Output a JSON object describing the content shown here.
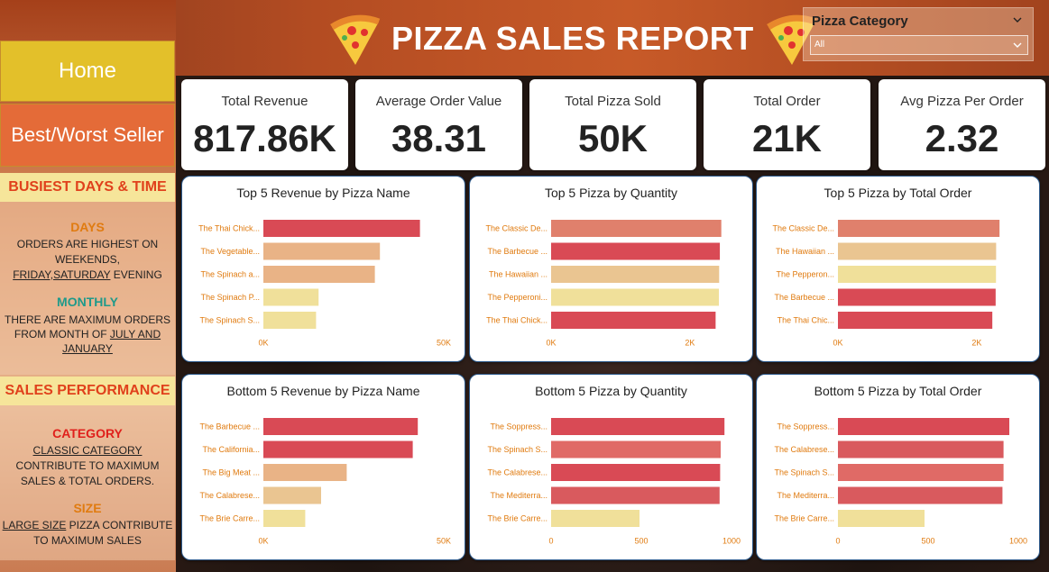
{
  "header": {
    "title": "PIZZA SALES REPORT"
  },
  "slicer": {
    "title": "Pizza Category",
    "value": "All"
  },
  "nav": {
    "home": "Home",
    "best_worst": "Best/Worst Seller"
  },
  "insights": {
    "busiest_head": "BUSIEST DAYS & TIME",
    "days_title": "DAYS",
    "days_line1": "ORDERS ARE HIGHEST ON",
    "days_line2": "WEEKENDS,",
    "days_line3": "FRIDAY,SATURDAY",
    "days_line3b": " EVENING",
    "monthly_title": "MONTHLY",
    "monthly_line1": "THERE ARE MAXIMUM ORDERS",
    "monthly_line2a": "FROM MONTH OF ",
    "monthly_line2b": "JULY AND",
    "monthly_line3": "JANUARY",
    "sales_head": "SALES PERFORMANCE",
    "category_title": "CATEGORY",
    "category_line1": "CLASSIC CATEGORY",
    "category_line2": "CONTRIBUTE TO MAXIMUM",
    "category_line3": "SALES & TOTAL ORDERS.",
    "size_title": "SIZE",
    "size_line1a": "LARGE SIZE",
    "size_line1b": " PIZZA CONTRIBUTE",
    "size_line2": "TO MAXIMUM SALES"
  },
  "kpis": [
    {
      "label": "Total Revenue",
      "value": "817.86K"
    },
    {
      "label": "Average Order Value",
      "value": "38.31"
    },
    {
      "label": "Total Pizza Sold",
      "value": "50K"
    },
    {
      "label": "Total Order",
      "value": "21K"
    },
    {
      "label": "Avg Pizza Per Order",
      "value": "2.32"
    }
  ],
  "colors": {
    "accent": "#e3c02a",
    "orange": "#e46b38",
    "label": "#e07b10",
    "dark_red": "#d94a55",
    "light_yellow": "#f0e09a"
  },
  "chart_data": [
    {
      "type": "bar",
      "title": "Top 5 Revenue by Pizza Name",
      "categories": [
        "The Thai Chick...",
        "The Vegetable...",
        "The Spinach a...",
        "The Spinach P...",
        "The Spinach S..."
      ],
      "values": [
        43400,
        32300,
        30900,
        15300,
        14600
      ],
      "colors": [
        "#d94a55",
        "#e9b386",
        "#e9b386",
        "#f0e09a",
        "#f0e09a"
      ],
      "xlim": [
        0,
        50000
      ],
      "ticks": [
        0,
        50000
      ],
      "tick_labels": [
        "0K",
        "50K"
      ]
    },
    {
      "type": "bar",
      "title": "Top 5 Pizza by Quantity",
      "categories": [
        "The Classic De...",
        "The Barbecue ...",
        "The Hawaiian ...",
        "The Pepperoni...",
        "The Thai Chick..."
      ],
      "values": [
        2453,
        2432,
        2422,
        2418,
        2371
      ],
      "colors": [
        "#e0806c",
        "#d94a55",
        "#eac591",
        "#f0e09a",
        "#d94a55"
      ],
      "xlim": [
        0,
        2600
      ],
      "ticks": [
        0,
        2000
      ],
      "tick_labels": [
        "0K",
        "2K"
      ]
    },
    {
      "type": "bar",
      "title": "Top 5 Pizza by Total Order",
      "categories": [
        "The Classic De...",
        "The Hawaiian ...",
        "The Pepperon...",
        "The Barbecue ...",
        "The Thai Chic..."
      ],
      "values": [
        2329,
        2280,
        2278,
        2273,
        2225
      ],
      "colors": [
        "#e0806c",
        "#eac591",
        "#f0e09a",
        "#d94a55",
        "#d94a55"
      ],
      "xlim": [
        0,
        2600
      ],
      "ticks": [
        0,
        2000
      ],
      "tick_labels": [
        "0K",
        "2K"
      ]
    },
    {
      "type": "bar",
      "title": "Bottom 5 Revenue by Pizza Name",
      "categories": [
        "The Barbecue ...",
        "The California...",
        "The Big Meat ...",
        "The Calabrese...",
        "The Brie Carre..."
      ],
      "values": [
        42800,
        41400,
        23100,
        16000,
        11600
      ],
      "colors": [
        "#d94a55",
        "#d94a55",
        "#e9b386",
        "#eac591",
        "#f0e09a"
      ],
      "xlim": [
        0,
        50000
      ],
      "ticks": [
        0,
        50000
      ],
      "tick_labels": [
        "0K",
        "50K"
      ]
    },
    {
      "type": "bar",
      "title": "Bottom 5 Pizza by Quantity",
      "categories": [
        "The Soppress...",
        "The Spinach S...",
        "The Calabrese...",
        "The Mediterra...",
        "The Brie Carre..."
      ],
      "values": [
        961,
        940,
        937,
        934,
        490
      ],
      "colors": [
        "#d94a55",
        "#e06a66",
        "#d94a55",
        "#d95a5e",
        "#f0e09a"
      ],
      "xlim": [
        0,
        1000
      ],
      "ticks": [
        0,
        500,
        1000
      ],
      "tick_labels": [
        "0",
        "500",
        "1000"
      ]
    },
    {
      "type": "bar",
      "title": "Bottom 5 Pizza by Total Order",
      "categories": [
        "The Soppress...",
        "The Calabrese...",
        "The Spinach S...",
        "The Mediterra...",
        "The Brie Carre..."
      ],
      "values": [
        950,
        918,
        918,
        912,
        480
      ],
      "colors": [
        "#d94a55",
        "#d95a5e",
        "#e06a66",
        "#d95a5e",
        "#f0e09a"
      ],
      "xlim": [
        0,
        1000
      ],
      "ticks": [
        0,
        500,
        1000
      ],
      "tick_labels": [
        "0",
        "500",
        "1000"
      ]
    }
  ]
}
